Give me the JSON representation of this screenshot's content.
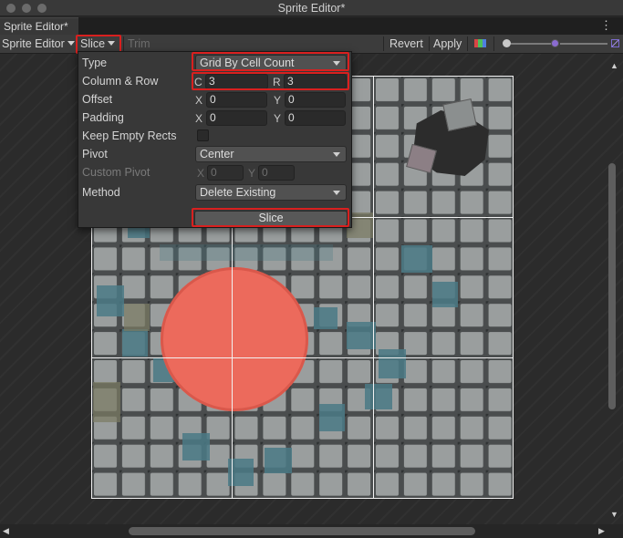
{
  "window": {
    "title": "Sprite Editor*"
  },
  "tab": {
    "label": "Sprite Editor*",
    "menu_icon": "kebab-menu-icon"
  },
  "toolbar": {
    "mode_label": "Sprite Editor",
    "slice_label": "Slice",
    "trim_label": "Trim",
    "revert_label": "Revert",
    "apply_label": "Apply",
    "color_channels_icon": "rgb-channels-icon",
    "zoom_icon": "mip-level-icon"
  },
  "slice_popup": {
    "type": {
      "label": "Type",
      "value": "Grid By Cell Count"
    },
    "column_row": {
      "label": "Column & Row",
      "c_label": "C",
      "c_value": "3",
      "r_label": "R",
      "r_value": "3"
    },
    "offset": {
      "label": "Offset",
      "x_label": "X",
      "x_value": "0",
      "y_label": "Y",
      "y_value": "0"
    },
    "padding": {
      "label": "Padding",
      "x_label": "X",
      "x_value": "0",
      "y_label": "Y",
      "y_value": "0"
    },
    "keep_empty": {
      "label": "Keep Empty Rects",
      "checked": false
    },
    "pivot": {
      "label": "Pivot",
      "value": "Center"
    },
    "custom_pivot": {
      "label": "Custom Pivot",
      "x_label": "X",
      "x_value": "0",
      "y_label": "Y",
      "y_value": "0"
    },
    "method": {
      "label": "Method",
      "value": "Delete Existing"
    },
    "slice_button": "Slice"
  },
  "colors": {
    "highlight": "#d9201f",
    "sprite_gray": "#8b8f8f",
    "circle_red": "#ec6a5c",
    "tile_teal": "#3f6e7a"
  }
}
